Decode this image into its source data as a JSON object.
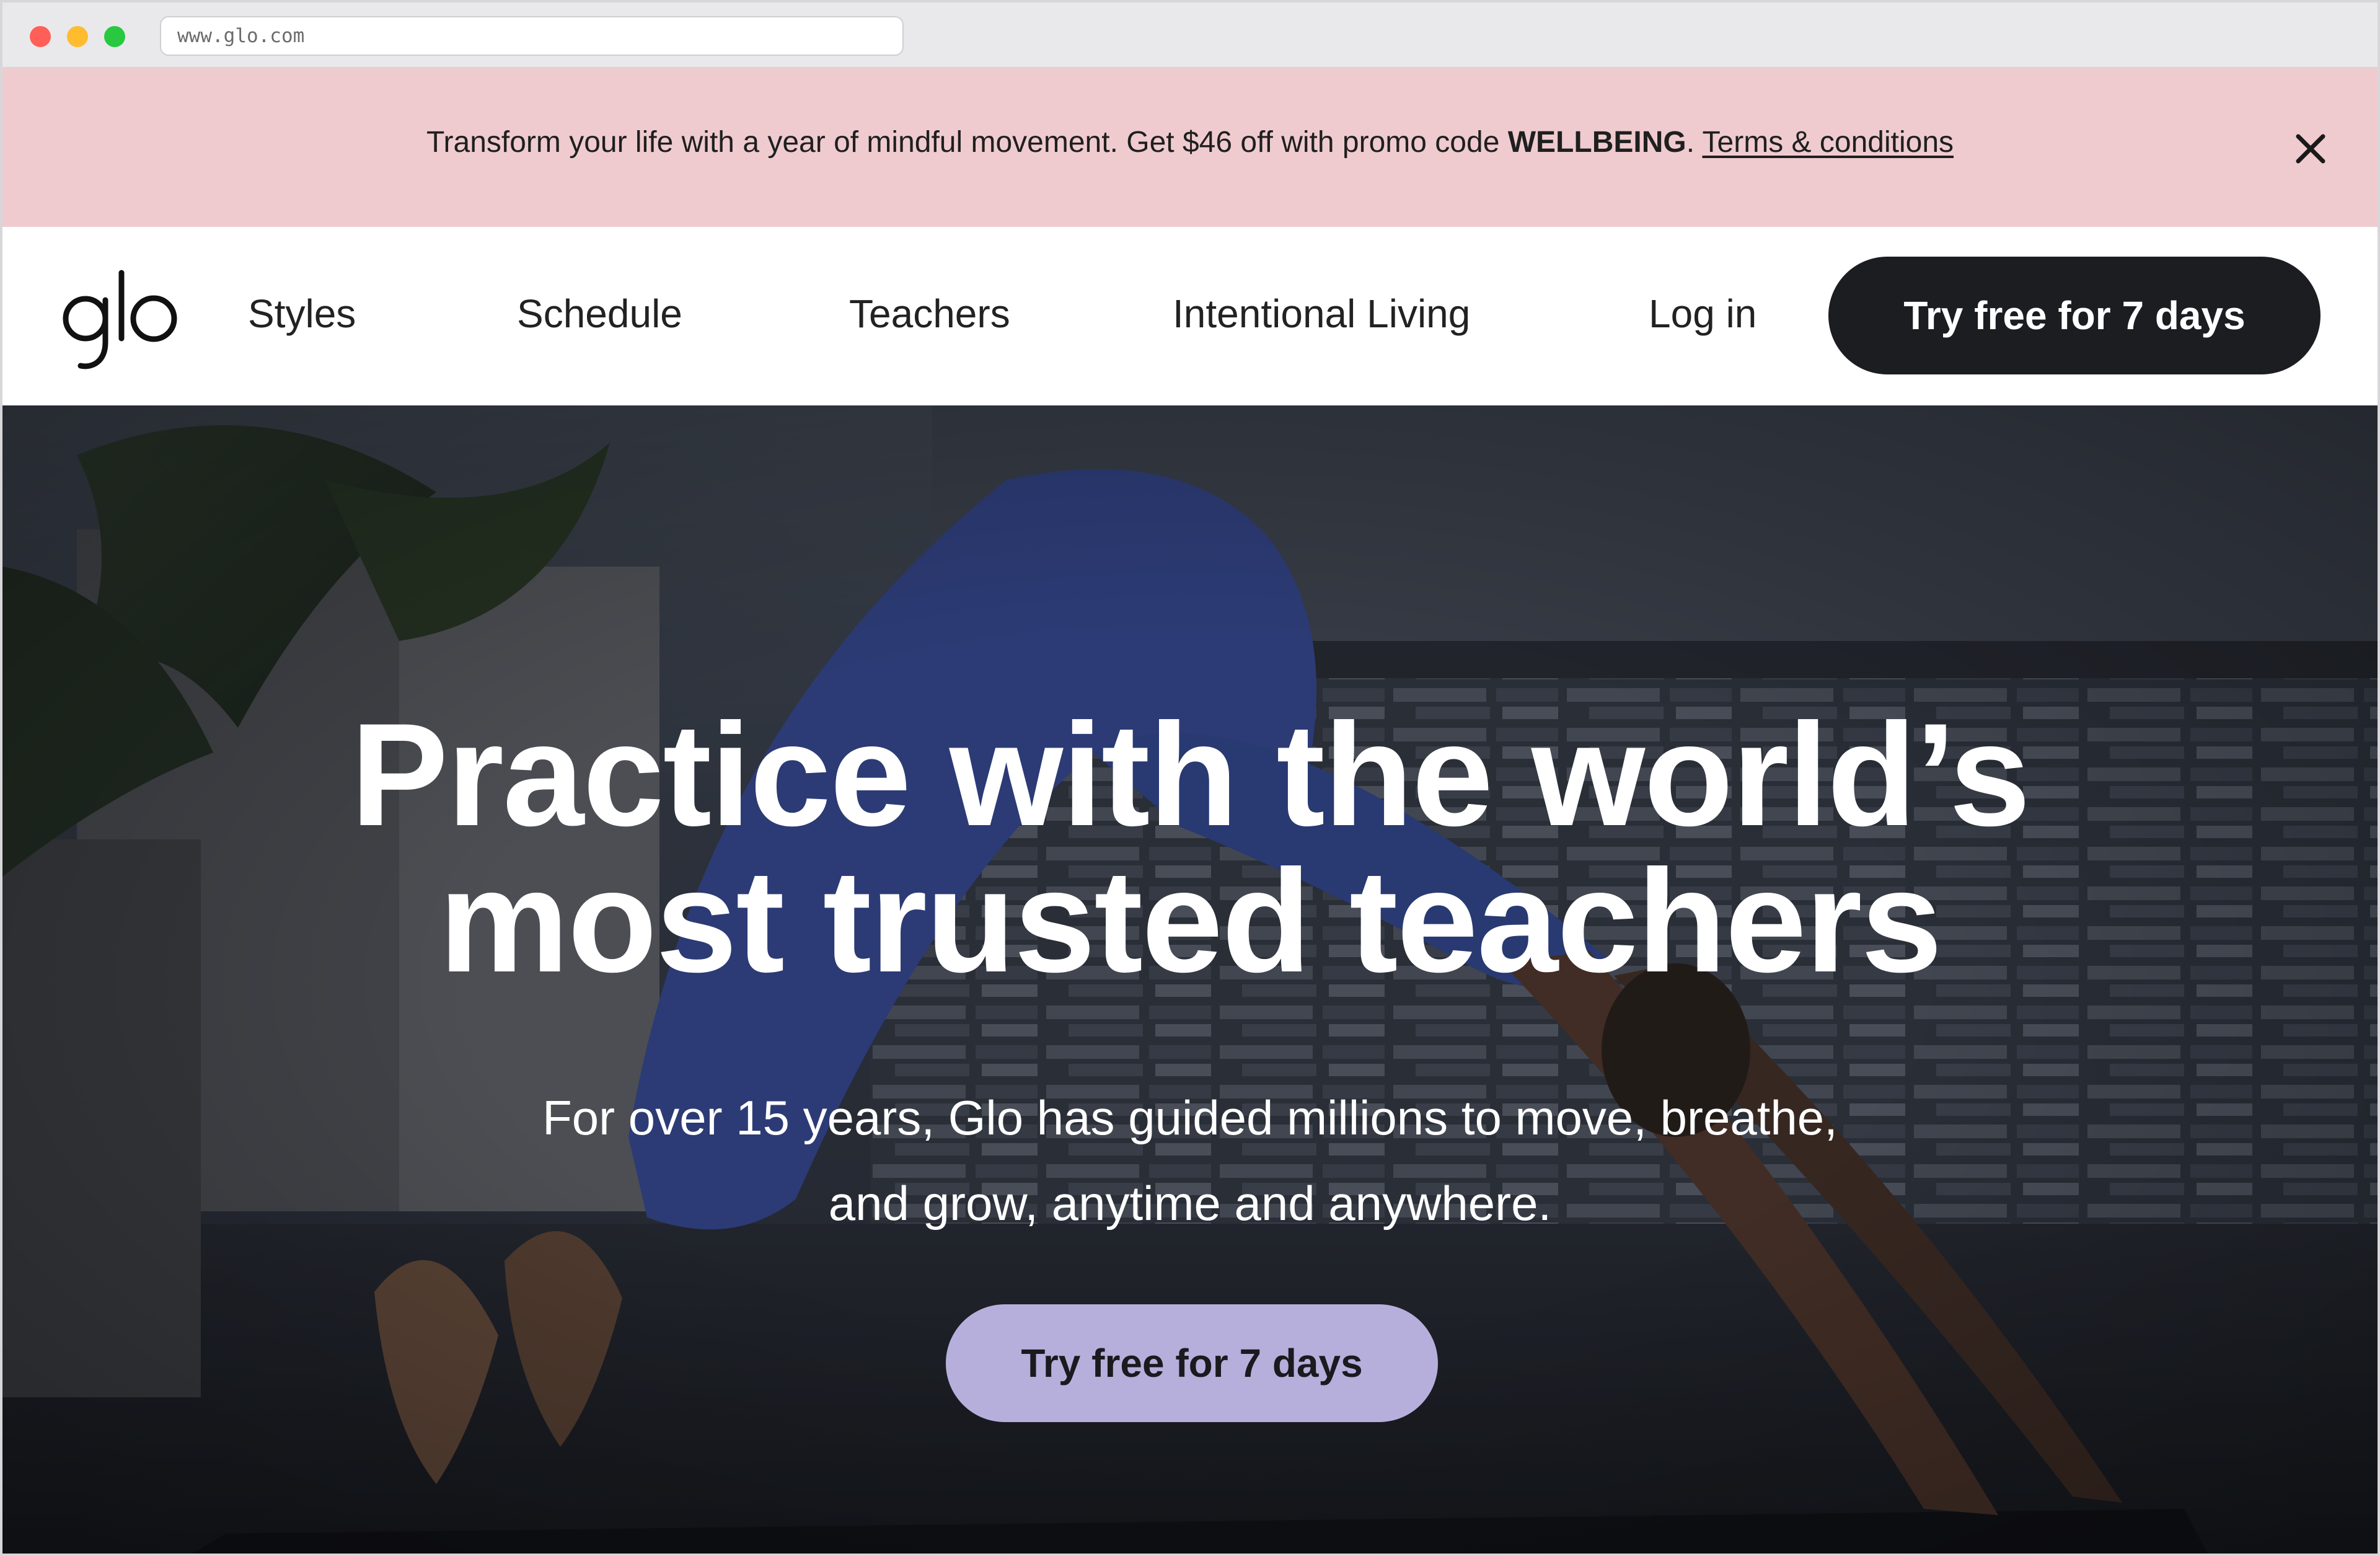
{
  "browser": {
    "url": "www.glo.com"
  },
  "promo": {
    "text_before": "Transform your life with a year of mindful movement. Get $46 off with promo code ",
    "code": "WELLBEING",
    "text_after": ". ",
    "terms_label": "Terms & conditions",
    "close_icon": "close-icon"
  },
  "nav": {
    "logo_text": "glo",
    "items": [
      {
        "label": "Styles"
      },
      {
        "label": "Schedule"
      },
      {
        "label": "Teachers"
      },
      {
        "label": "Intentional Living"
      }
    ],
    "login_label": "Log in",
    "cta_label": "Try free for 7 days"
  },
  "hero": {
    "title_line1": "Practice with the world’s",
    "title_line2": "most trusted teachers",
    "subtitle_line1": "For over 15 years, Glo has guided millions to move, breathe,",
    "subtitle_line2": "and grow, anytime and anywhere.",
    "cta_label": "Try free for 7 days"
  },
  "colors": {
    "promo_bg": "#efcbcf",
    "nav_cta_bg": "#1c1d21",
    "hero_cta_bg": "#b6afdc"
  }
}
